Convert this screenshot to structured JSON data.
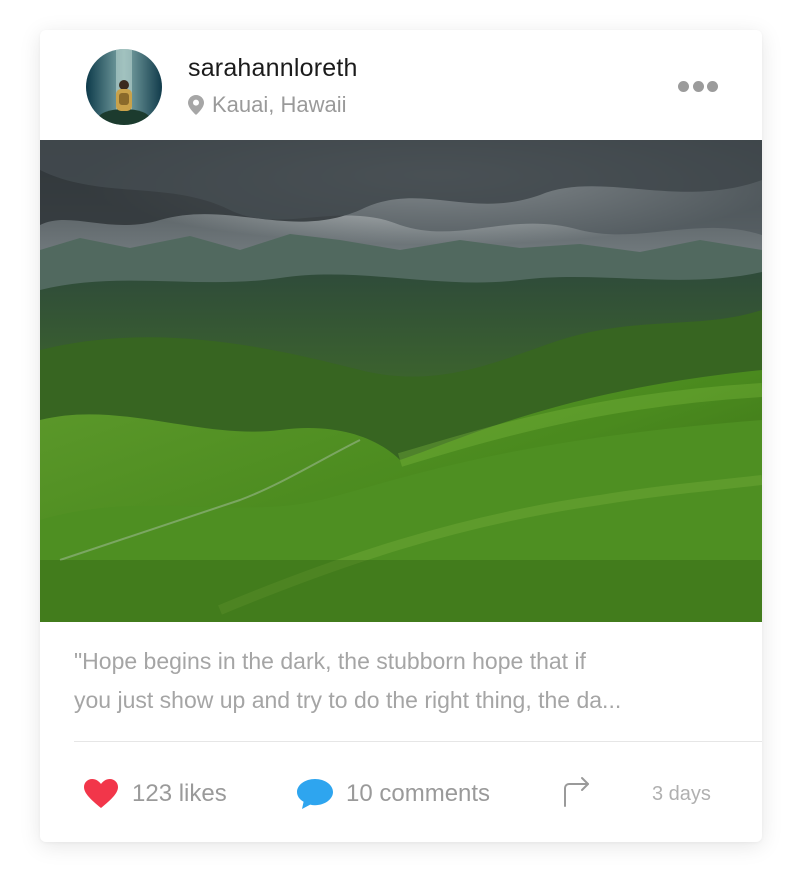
{
  "post": {
    "username": "sarahannloreth",
    "location": "Kauai, Hawaii",
    "caption_line1": "\"Hope begins in the dark, the stubborn hope that if",
    "caption_line2": "you just show up and try to do the right thing, the da...",
    "likes": "123 likes",
    "comments": "10 comments",
    "time": "3 days"
  },
  "icons": {
    "location": "location-pin-icon",
    "more": "more-dots-icon",
    "like": "heart-icon",
    "comment": "speech-bubble-icon",
    "share": "share-arrow-icon"
  },
  "colors": {
    "heart": "#f2364a",
    "comment_bubble": "#2ea5ef",
    "muted_text": "#9a9a9a",
    "username": "#1b1b1b"
  }
}
